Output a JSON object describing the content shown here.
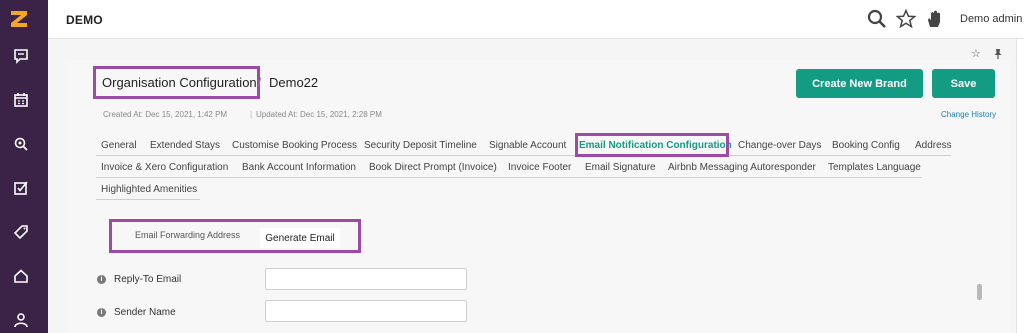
{
  "app": {
    "title": "DEMO"
  },
  "header": {
    "user_label": "Demo admin",
    "icons": [
      "search-icon",
      "star-icon",
      "hand-icon"
    ]
  },
  "sidebar": {
    "logo": "z-logo-icon",
    "items": [
      {
        "icon": "chat-icon"
      },
      {
        "icon": "calendar-icon"
      },
      {
        "icon": "location-search-icon"
      },
      {
        "icon": "checklist-icon"
      },
      {
        "icon": "tag-icon"
      },
      {
        "icon": "home-icon"
      },
      {
        "icon": "user-icon"
      }
    ]
  },
  "breadcrumb": {
    "root": "Organisation Configuration",
    "separator": "/",
    "current": "Demo22"
  },
  "buttons": {
    "create_brand": "Create New Brand",
    "save": "Save"
  },
  "meta": {
    "created": "Created At: Dec 15, 2021, 1:42 PM",
    "separator": "|",
    "updated": "Updated At: Dec 15, 2021, 2:28 PM",
    "change_history": "Change History"
  },
  "tabs": {
    "row1": [
      "General",
      "Extended Stays",
      "Customise Booking Process",
      "Security Deposit Timeline",
      "Signable Account",
      "Email Notification Configuration",
      "Change-over Days",
      "Booking Config",
      "Address"
    ],
    "row2": [
      "Invoice & Xero Configuration",
      "Bank Account Information",
      "Book Direct Prompt (Invoice)",
      "Invoice Footer",
      "Email Signature",
      "Airbnb Messaging Autoresponder",
      "Templates Language"
    ],
    "row3": [
      "Highlighted Amenities"
    ],
    "active": "Email Notification Configuration"
  },
  "subtabs": {
    "forwarding": "Email Forwarding Address",
    "generate": "Generate Email"
  },
  "form": {
    "reply_to_label": "Reply-To Email",
    "reply_to_value": "",
    "sender_name_label": "Sender Name",
    "sender_name_value": ""
  },
  "colors": {
    "sidebar": "#3a2347",
    "accent": "#139b84",
    "highlight": "#9b4aa6",
    "logo": "#f5a623"
  }
}
